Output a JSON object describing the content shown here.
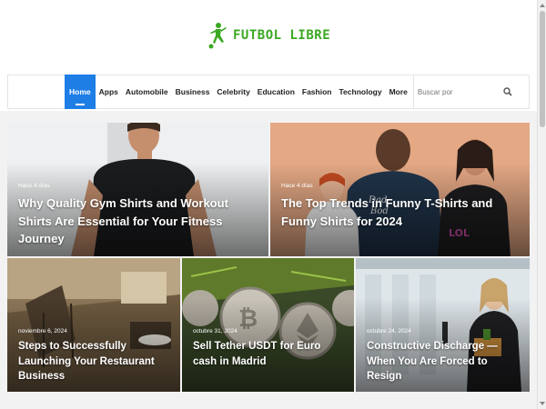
{
  "site": {
    "logo_text": "FUTBOL LIBRE",
    "brand_color": "#3aa821",
    "accent_color": "#1e7ee6"
  },
  "nav": {
    "items": [
      {
        "label": "Home",
        "active": true
      },
      {
        "label": "Apps"
      },
      {
        "label": "Automobile"
      },
      {
        "label": "Business"
      },
      {
        "label": "Celebrity"
      },
      {
        "label": "Education"
      },
      {
        "label": "Fashion"
      },
      {
        "label": "Technology"
      },
      {
        "label": "More"
      }
    ],
    "search_placeholder": "Buscar por",
    "search_icon": "search-icon"
  },
  "posts": [
    {
      "date": "Hace 4 días",
      "title": "Why Quality Gym Shirts and Workout Shirts Are Essential for Your Fitness Journey"
    },
    {
      "date": "Hace 4 días",
      "title": "The Top Trends in Funny T-Shirts and Funny Shirts for 2024"
    },
    {
      "date": "noviembre 6, 2024",
      "title": "Steps to Successfully Launching Your Restaurant Business"
    },
    {
      "date": "octubre 31, 2024",
      "title": "Sell Tether USDT for Euro cash in Madrid"
    },
    {
      "date": "octubre 24, 2024",
      "title": "Constructive Discharge — When You Are Forced to Resign"
    }
  ]
}
